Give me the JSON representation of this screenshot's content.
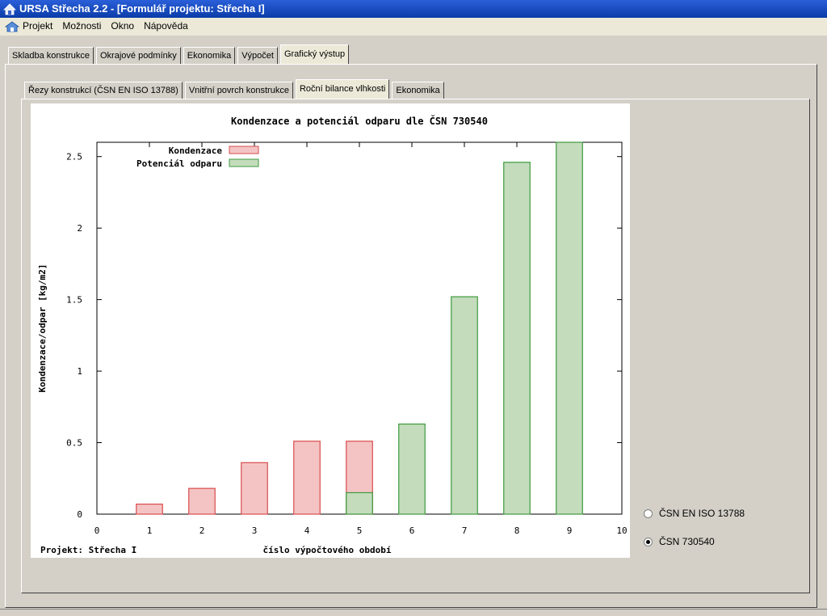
{
  "window": {
    "title": "URSA Střecha 2.2 - [Formulář projektu: Střecha I]"
  },
  "menu": {
    "items": [
      "Projekt",
      "Možnosti",
      "Okno",
      "Nápověda"
    ]
  },
  "main_tabs": [
    {
      "label": "Skladba konstrukce",
      "active": false
    },
    {
      "label": "Okrajové podmínky",
      "active": false
    },
    {
      "label": "Ekonomika",
      "active": false
    },
    {
      "label": "Výpočet",
      "active": false
    },
    {
      "label": "Grafický výstup",
      "active": true
    }
  ],
  "sub_tabs": [
    {
      "label": "Řezy konstrukcí (ČSN EN ISO 13788)",
      "active": false
    },
    {
      "label": "Vnitřní povrch konstrukce",
      "active": false
    },
    {
      "label": "Roční bilance vlhkosti",
      "active": true
    },
    {
      "label": "Ekonomika",
      "active": false
    }
  ],
  "chart_data": {
    "type": "bar",
    "title": "Kondenzace a potenciál odparu dle ČSN 730540",
    "xlabel": "číslo výpočtového období",
    "ylabel": "Kondenzace/odpar [kg/m2]",
    "xlim": [
      0,
      10
    ],
    "ylim": [
      0,
      2.6
    ],
    "xticks": [
      0,
      1,
      2,
      3,
      4,
      5,
      6,
      7,
      8,
      9,
      10
    ],
    "yticks": [
      0,
      0.5,
      1,
      1.5,
      2,
      2.5
    ],
    "ytick_labels": [
      "0",
      "0.5",
      "1",
      "1.5",
      "2",
      "2.5"
    ],
    "legend_position": "top-left",
    "series": [
      {
        "name": "Kondenzace",
        "color": "#f4c4c4",
        "stroke": "#d94c4c",
        "x": [
          1,
          2,
          3,
          4,
          5
        ],
        "values": [
          0.07,
          0.18,
          0.36,
          0.51,
          0.51
        ]
      },
      {
        "name": "Potenciál odparu",
        "color": "#c4dcbc",
        "stroke": "#3e9a3e",
        "x": [
          5,
          6,
          7,
          8,
          9
        ],
        "values": [
          0.15,
          0.63,
          1.52,
          2.46,
          2.6
        ]
      }
    ],
    "footer": "Projekt: Střecha I"
  },
  "radio_options": [
    {
      "label": "ČSN EN ISO 13788",
      "checked": false
    },
    {
      "label": "ČSN 730540",
      "checked": true
    }
  ]
}
